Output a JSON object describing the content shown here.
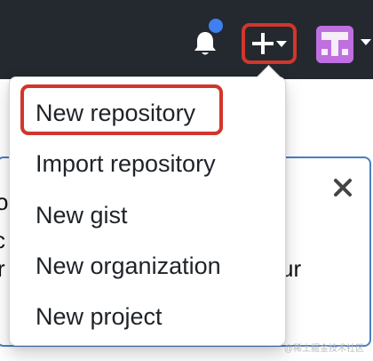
{
  "header": {
    "menu_items": [
      "New repository",
      "Import repository",
      "New gist",
      "New organization",
      "New project"
    ],
    "colors": {
      "header_bg": "#24292f",
      "highlight_red": "#d1362b",
      "notification_blue": "#3f7ff0",
      "avatar_purple": "#bf6fe0"
    }
  },
  "background": {
    "fragments": [
      "o",
      "c",
      "r",
      "ur"
    ]
  },
  "watermark": "@稀土掘金技术社区",
  "icons": {
    "notification": "bell-icon",
    "create": "plus-icon",
    "caret": "caret-down-icon",
    "close": "close-icon"
  }
}
